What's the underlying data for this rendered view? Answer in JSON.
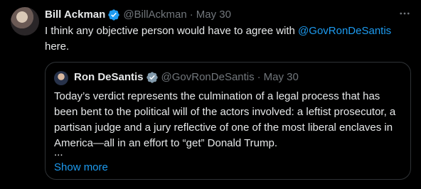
{
  "tweet": {
    "author_name": "Bill Ackman",
    "handle": "@BillAckman",
    "separator": "·",
    "date": "May 30",
    "text_before": "I think any objective person would have to agree with ",
    "mention": "@GovRonDeSantis",
    "text_after": "here.",
    "verified_badge_color": "#1d9bf0",
    "more_icon": "more-horizontal-icon"
  },
  "quote": {
    "author_name": "Ron DeSantis",
    "handle": "@GovRonDeSantis",
    "separator": "·",
    "date": "May 30",
    "text": "Today’s verdict represents the culmination of a legal process that has been bent to the political will of the actors involved: a leftist prosecutor, a partisan judge and a jury reflective of one of the most liberal enclaves in America—all in an effort to “get” Donald Trump.",
    "ellipsis": "...",
    "show_more": "Show more",
    "verified_badge_color": "#829aab"
  },
  "colors": {
    "background": "#000000",
    "text": "#e7e9ea",
    "muted": "#71767b",
    "link": "#1d9bf0",
    "border": "#2f3336"
  }
}
